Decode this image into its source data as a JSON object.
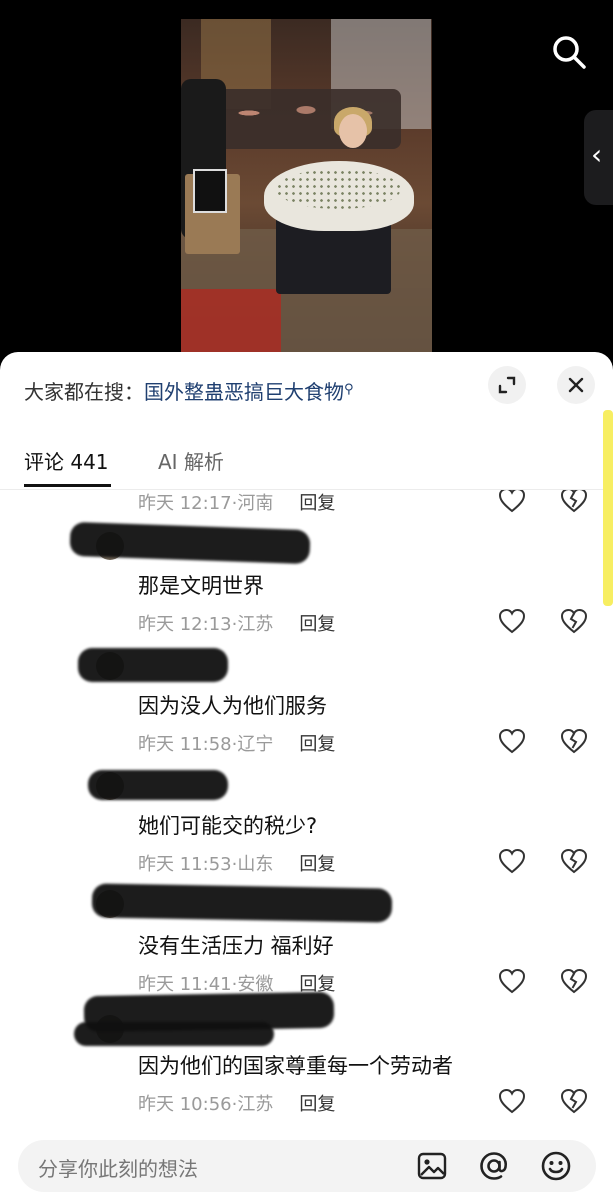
{
  "search_hint": {
    "prefix": "大家都在搜：",
    "query": "国外整蛊恶搞巨大食物"
  },
  "tabs": [
    {
      "label": "评论 441",
      "active": true
    },
    {
      "label": "AI 解析",
      "active": false
    }
  ],
  "comments": [
    {
      "text": "",
      "time": "昨天 12:17",
      "location": "河南",
      "reply_label": "回复"
    },
    {
      "text": "那是文明世界",
      "time": "昨天 12:13",
      "location": "江苏",
      "reply_label": "回复"
    },
    {
      "text": "因为没人为他们服务",
      "time": "昨天 11:58",
      "location": "辽宁",
      "reply_label": "回复"
    },
    {
      "text": "她们可能交的税少?",
      "time": "昨天 11:53",
      "location": "山东",
      "reply_label": "回复"
    },
    {
      "text": "没有生活压力 福利好",
      "time": "昨天 11:41",
      "location": "安徽",
      "reply_label": "回复"
    },
    {
      "text": "因为他们的国家尊重每一个劳动者",
      "time": "昨天 10:56",
      "location": "江苏",
      "reply_label": "回复"
    }
  ],
  "meta_separator": "·",
  "input": {
    "placeholder": "分享你此刻的想法"
  },
  "icons": {
    "search": "search-icon",
    "side_panel": "chevron-left-icon",
    "expand": "expand-icon",
    "close": "close-icon",
    "like": "heart-icon",
    "dislike": "broken-heart-icon",
    "image": "image-icon",
    "mention": "at-icon",
    "emoji": "emoji-icon"
  }
}
